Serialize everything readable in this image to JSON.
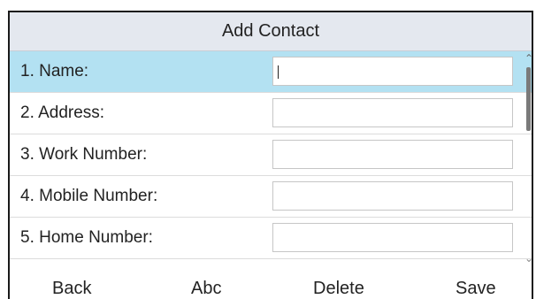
{
  "title": "Add Contact",
  "fields": [
    {
      "label": "1. Name:",
      "value": ""
    },
    {
      "label": "2. Address:",
      "value": ""
    },
    {
      "label": "3. Work Number:",
      "value": ""
    },
    {
      "label": "4. Mobile Number:",
      "value": ""
    },
    {
      "label": "5. Home Number:",
      "value": ""
    }
  ],
  "softkeys": [
    "Back",
    "Abc",
    "Delete",
    "Save"
  ],
  "colors": {
    "selected_row": "#b3e1f2",
    "title_bar": "#e4e8ef"
  },
  "icons": {
    "scroll_up": "chevron-up-icon",
    "scroll_down": "chevron-down-icon"
  }
}
